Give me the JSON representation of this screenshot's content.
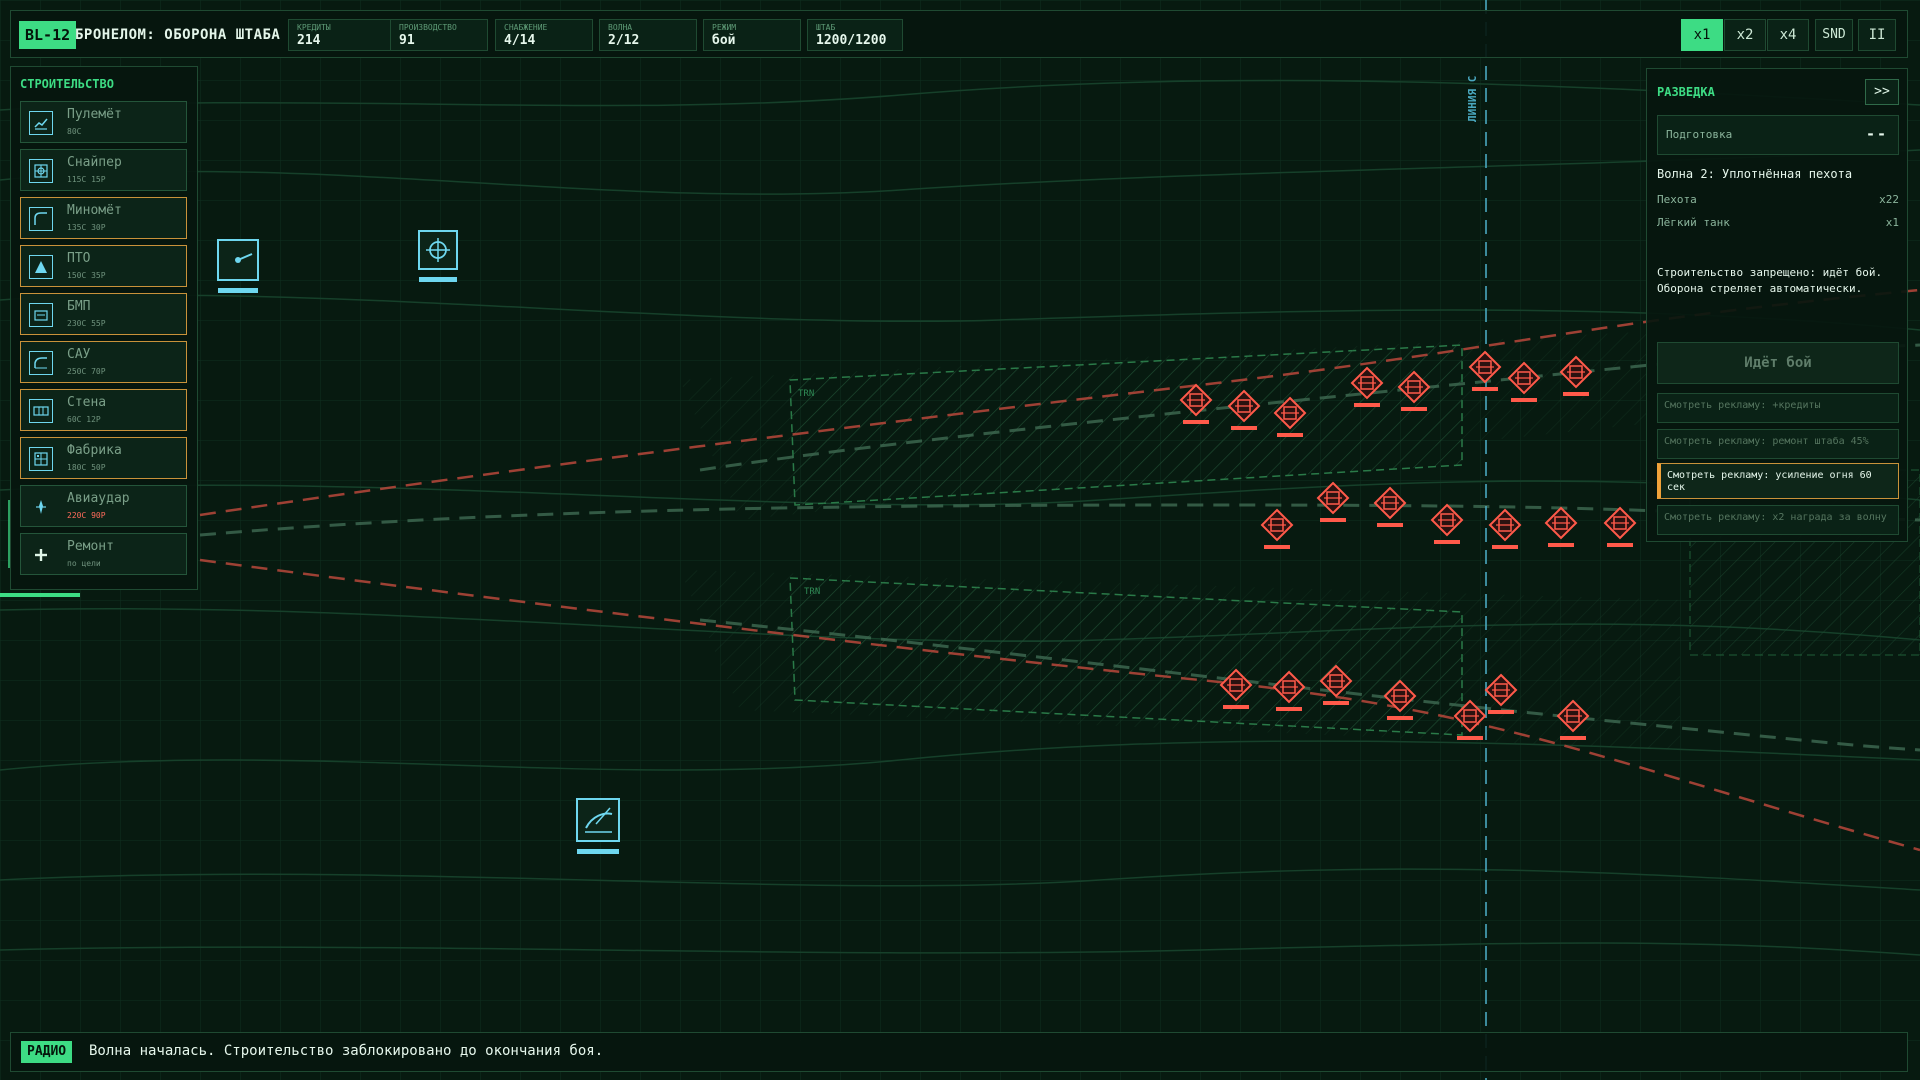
{
  "header": {
    "id_badge": "BL-12",
    "title": "БРОНЕЛОМ: ОБОРОНА ШТАБА",
    "stats": [
      {
        "label": "КРЕДИТЫ",
        "value": "214"
      },
      {
        "label": "ПРОИЗВОДСТВО",
        "value": "91"
      },
      {
        "label": "СНАБЖЕНИЕ",
        "value": "4/14"
      },
      {
        "label": "ВОЛНА",
        "value": "2/12"
      },
      {
        "label": "РЕЖИМ",
        "value": "бой"
      },
      {
        "label": "ШТАБ",
        "value": "1200/1200"
      }
    ],
    "speed": [
      {
        "label": "x1",
        "active": true
      },
      {
        "label": "x2",
        "active": false
      },
      {
        "label": "x4",
        "active": false
      }
    ],
    "sound_label": "SND",
    "pause_label": "II"
  },
  "build": {
    "title": "СТРОИТЕЛЬСТВО",
    "items": [
      {
        "name": "Пулемёт",
        "cost": "80C",
        "icon": "machine-gun-icon",
        "highlight": false,
        "cost_red": false
      },
      {
        "name": "Снайпер",
        "cost": "115C 15P",
        "icon": "sniper-icon",
        "highlight": false,
        "cost_red": false
      },
      {
        "name": "Миномёт",
        "cost": "135C 30P",
        "icon": "mortar-icon",
        "highlight": true,
        "cost_red": false
      },
      {
        "name": "ПТО",
        "cost": "150C 35P",
        "icon": "anti-tank-gun-icon",
        "highlight": true,
        "cost_red": false
      },
      {
        "name": "БМП",
        "cost": "230C 55P",
        "icon": "ifv-icon",
        "highlight": true,
        "cost_red": false
      },
      {
        "name": "САУ",
        "cost": "250C 70P",
        "icon": "spg-icon",
        "highlight": true,
        "cost_red": false
      },
      {
        "name": "Стена",
        "cost": "60C 12P",
        "icon": "wall-icon",
        "highlight": true,
        "cost_red": false
      },
      {
        "name": "Фабрика",
        "cost": "180C 50P",
        "icon": "factory-icon",
        "highlight": true,
        "cost_red": false
      },
      {
        "name": "Авиаудар",
        "cost": "220C 90P",
        "icon": "airstrike-icon",
        "highlight": false,
        "cost_red": true
      },
      {
        "name": "Ремонт",
        "cost": "по цели",
        "icon": "repair-icon",
        "highlight": false,
        "cost_red": false
      }
    ]
  },
  "recon": {
    "title": "РАЗВЕДКА",
    "collapse_label": ">>",
    "prep_label": "Подготовка",
    "prep_value": "--",
    "wave_name": "Волна 2: Уплотнённая пехота",
    "enemies": [
      {
        "name": "Пехота",
        "count": "x22"
      },
      {
        "name": "Лёгкий танк",
        "count": "x1"
      }
    ],
    "message": "Строительство запрещено: идёт бой. Оборона стреляет автоматически.",
    "battle_button": "Идёт бой",
    "ads": [
      {
        "label": "Смотреть рекламу: +кредиты",
        "active": false
      },
      {
        "label": "Смотреть рекламу: ремонт штаба 45%",
        "active": false
      },
      {
        "label": "Смотреть рекламу: усиление огня 60 сек",
        "active": true
      },
      {
        "label": "Смотреть рекламу: x2 награда за волну",
        "active": false
      }
    ]
  },
  "map": {
    "frontline_label": "ЛИНИЯ С",
    "zone_labels": [
      "TRN",
      "TRN"
    ],
    "towers": [
      {
        "kind": "machine-gun",
        "hp": 1.0
      },
      {
        "kind": "sniper",
        "hp": 1.0
      },
      {
        "kind": "spg",
        "hp": 1.0
      }
    ],
    "enemy_count": 27
  },
  "radio": {
    "label": "РАДИО",
    "message": "Волна началась. Строительство заблокировано до окончания боя."
  },
  "colors": {
    "accent": "#3ddc84",
    "enemy": "#ff5a4a",
    "tower": "#6ed7ef",
    "warning": "#c9923a"
  }
}
